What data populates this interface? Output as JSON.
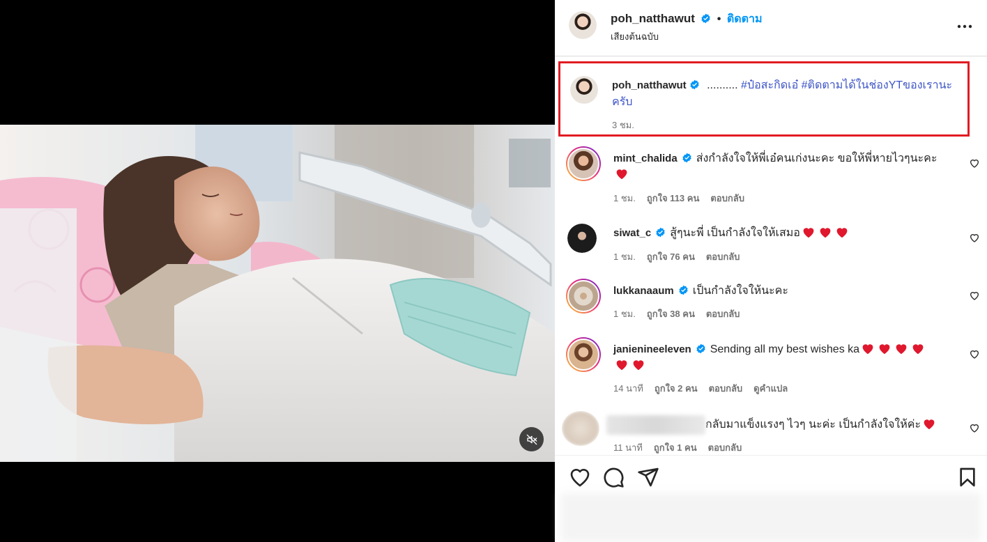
{
  "post": {
    "author": "poh_natthawut",
    "follow_label": "ติดตาม",
    "separator": "•",
    "audio_label": "เสียงต้นฉบับ"
  },
  "caption": {
    "author": "poh_natthawut",
    "text_prefix": "..........",
    "hashtag1": "#ป๋อสะกิดเอ๋",
    "hashtag2": "#ติดตามได้ในช่องYTของเรานะ",
    "text_suffix": "ครับ",
    "time": "3 ชม.",
    "highlight_color": "#e11b22"
  },
  "comments": [
    {
      "user": "mint_chalida",
      "text": "ส่งกำลังใจให้พี่เอ๋คนเก่งนะคะ ขอให้พี่หายไวๆนะคะ",
      "hearts": 1,
      "time": "1 ชม.",
      "likes": "ถูกใจ 113 คน",
      "reply": "ตอบกลับ"
    },
    {
      "user": "siwat_c",
      "text": "สู้ๆนะพี่ เป็นกำลังใจให้เสมอ",
      "hearts": 3,
      "time": "1 ชม.",
      "likes": "ถูกใจ 76 คน",
      "reply": "ตอบกลับ"
    },
    {
      "user": "lukkanaaum",
      "text": "เป็นกำลังใจให้นะคะ",
      "hearts": 0,
      "time": "1 ชม.",
      "likes": "ถูกใจ 38 คน",
      "reply": "ตอบกลับ"
    },
    {
      "user": "janienineeleven",
      "text": "Sending all my best wishes ka",
      "hearts": 6,
      "time": "14 นาที",
      "likes": "ถูกใจ 2 คน",
      "reply": "ตอบกลับ",
      "translate": "ดูคำแปล"
    },
    {
      "user": "",
      "text": "กลับมาแข็งแรงๆ ไวๆ นะค่ะ เป็นกำลังใจให้ค่ะ",
      "hearts": 1,
      "time": "11 นาที",
      "likes": "ถูกใจ 1 คน",
      "reply": "ตอบกลับ"
    }
  ],
  "icons": {
    "more": "more-horizontal-icon",
    "verified": "verified-badge-icon",
    "like": "heart-outline-icon",
    "comment": "comment-icon",
    "share": "share-icon",
    "save": "bookmark-icon",
    "mute": "muted-speaker-icon"
  },
  "colors": {
    "link": "#0095f6",
    "verified": "#0095f6",
    "heart": "#e0182d",
    "muted_text": "#737373"
  }
}
